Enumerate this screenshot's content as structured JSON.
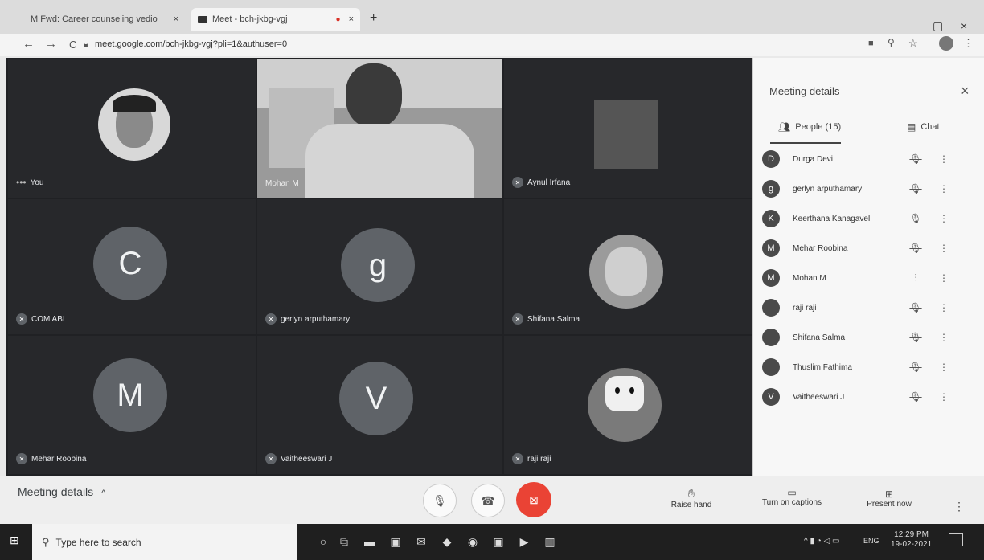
{
  "browser": {
    "tabs": [
      {
        "label": "M Fwd: Career counseling vedio - ...",
        "close": "×"
      },
      {
        "label": "Meet - bch-jkbg-vgj",
        "close": "×"
      }
    ],
    "new_tab": "+",
    "url": "meet.google.com/bch-jkbg-vgj?pli=1&authuser=0",
    "window_controls": {
      "minimize": "–",
      "maximize": "▢",
      "close": "×"
    },
    "nav": {
      "back": "←",
      "forward": "→",
      "reload": "C"
    }
  },
  "meet": {
    "tiles": [
      {
        "name": "You",
        "initial": ""
      },
      {
        "name": "Mohan M",
        "initial": ""
      },
      {
        "name": "Aynul Irfana",
        "initial": ""
      },
      {
        "name": "COM ABI",
        "initial": "C"
      },
      {
        "name": "gerlyn arputhamary",
        "initial": "g"
      },
      {
        "name": "Shifana Salma",
        "initial": ""
      },
      {
        "name": "Mehar Roobina",
        "initial": "M"
      },
      {
        "name": "Vaitheeswari J",
        "initial": "V"
      },
      {
        "name": "raji raji",
        "initial": ""
      }
    ]
  },
  "sidebar": {
    "title": "Meeting details",
    "close": "×",
    "tab_people": "People (15)",
    "tab_chat": "Chat",
    "people": [
      {
        "initial": "D",
        "name": "Durga Devi",
        "mic": "muted"
      },
      {
        "initial": "g",
        "name": "gerlyn arputhamary",
        "mic": "muted"
      },
      {
        "initial": "K",
        "name": "Keerthana Kanagavel",
        "mic": "muted"
      },
      {
        "initial": "M",
        "name": "Mehar Roobina",
        "mic": "muted"
      },
      {
        "initial": "M",
        "name": "Mohan M",
        "mic": "speaking"
      },
      {
        "initial": "",
        "name": "raji raji",
        "mic": "muted"
      },
      {
        "initial": "",
        "name": "Shifana Salma",
        "mic": "muted"
      },
      {
        "initial": "",
        "name": "Thuslim Fathima",
        "mic": "muted"
      },
      {
        "initial": "V",
        "name": "Vaitheeswari J",
        "mic": "muted"
      }
    ]
  },
  "bottom": {
    "meeting_details": "Meeting details",
    "raise_hand": "Raise hand",
    "captions": "Turn on captions",
    "present": "Present now"
  },
  "taskbar": {
    "search_placeholder": "Type here to search",
    "lang": "ENG",
    "time": "12:29 PM",
    "date": "19-02-2021"
  },
  "colors": {
    "meet_bg": "#202124",
    "hangup": "#ea4335",
    "sidebar_bg": "#f7f7f7"
  }
}
